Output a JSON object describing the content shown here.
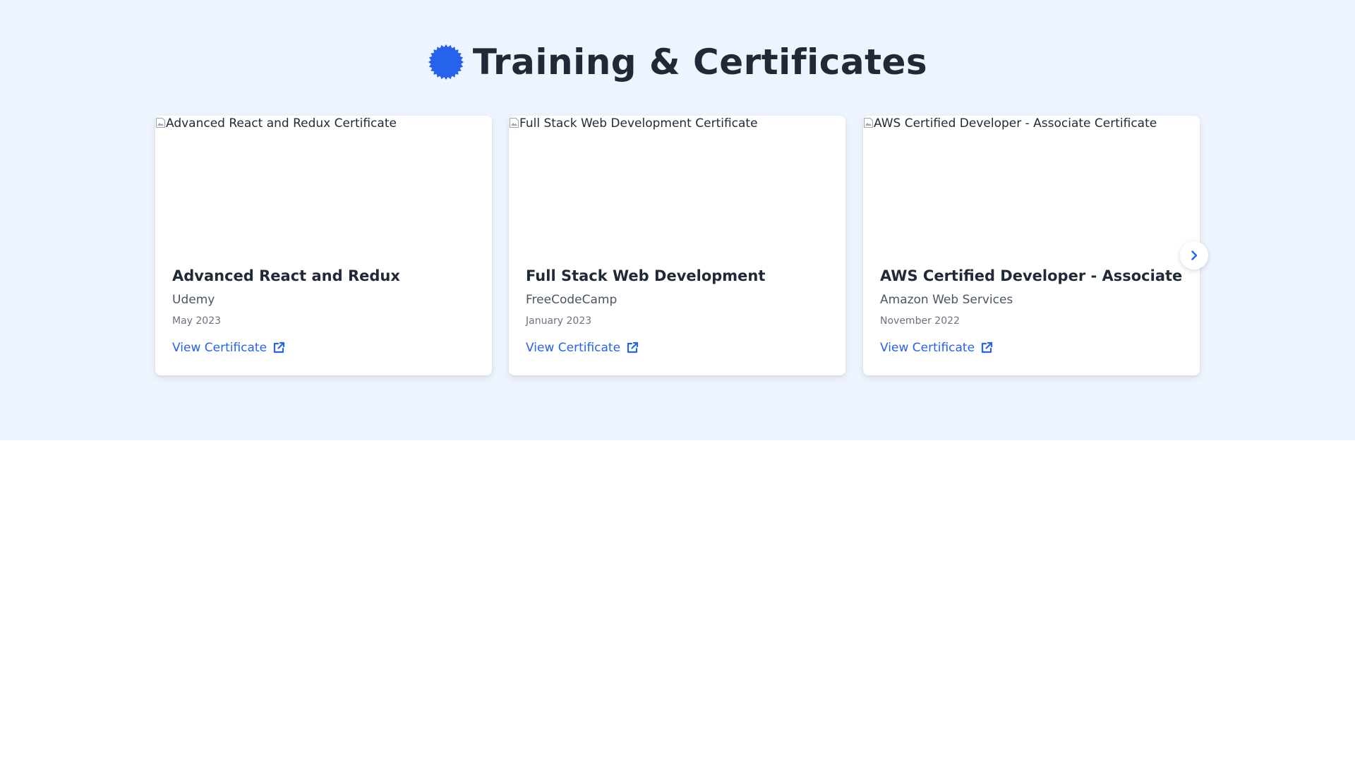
{
  "section": {
    "title": "Training & Certificates",
    "title_icon": "certificate-badge-icon",
    "accent_color": "#2563eb",
    "background_color": "#eef4fe"
  },
  "certificates": [
    {
      "image_alt": "Advanced React and Redux Certificate",
      "title": "Advanced React and Redux",
      "issuer": "Udemy",
      "date": "May 2023",
      "link_label": "View Certificate",
      "link_icon": "external-link-icon"
    },
    {
      "image_alt": "Full Stack Web Development Certificate",
      "title": "Full Stack Web Development",
      "issuer": "FreeCodeCamp",
      "date": "January 2023",
      "link_label": "View Certificate",
      "link_icon": "external-link-icon"
    },
    {
      "image_alt": "AWS Certified Developer - Associate Certificate",
      "title": "AWS Certified Developer - Associate",
      "issuer": "Amazon Web Services",
      "date": "November 2022",
      "link_label": "View Certificate",
      "link_icon": "external-link-icon"
    }
  ],
  "carousel": {
    "next_icon": "chevron-right-icon"
  }
}
